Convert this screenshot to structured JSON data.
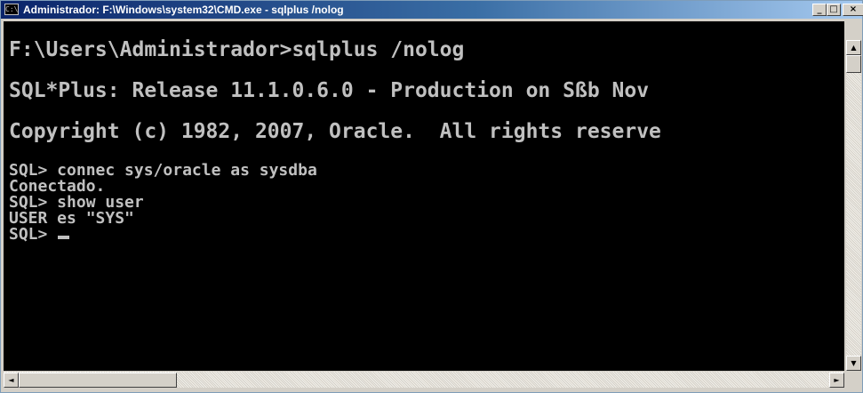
{
  "window": {
    "title": "Administrador: F:\\Windows\\system32\\CMD.exe - sqlplus  /nolog",
    "icon_label": "C:\\",
    "buttons": {
      "minimize": "_",
      "maximize": "□",
      "close": "×"
    }
  },
  "console": {
    "lines": [
      "F:\\Users\\Administrador>sqlplus /nolog",
      "SQL*Plus: Release 11.1.0.6.0 - Production on Sßb Nov",
      "Copyright (c) 1982, 2007, Oracle.  All rights reserve",
      "SQL> connec sys/oracle as sysdba",
      "Conectado.",
      "SQL> show user",
      "USER es \"SYS\"",
      "SQL> "
    ]
  },
  "scrollbars": {
    "up_arrow": "▲",
    "down_arrow": "▼",
    "left_arrow": "◄",
    "right_arrow": "►"
  },
  "colors": {
    "console_bg": "#000000",
    "console_text": "#c0c0c0",
    "title_gradient_start": "#0a246a",
    "title_gradient_end": "#a6caf0"
  }
}
